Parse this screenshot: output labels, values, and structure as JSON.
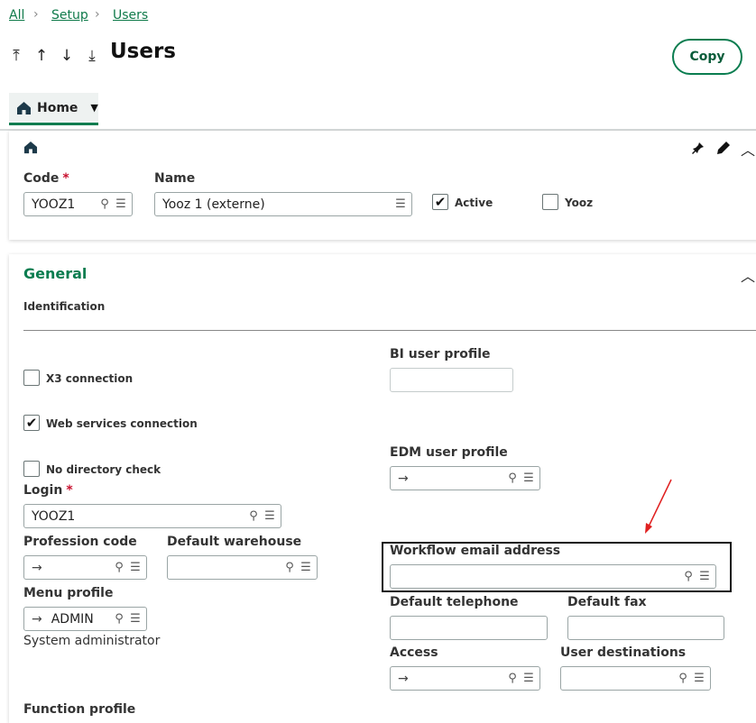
{
  "breadcrumb": {
    "items": [
      "All",
      "Setup",
      "Users"
    ]
  },
  "page": {
    "title": "Users",
    "copy_label": "Copy"
  },
  "tabs": {
    "home_label": "Home"
  },
  "header_card": {
    "code_label": "Code",
    "code_value": "YOOZ1",
    "name_label": "Name",
    "name_value": "Yooz 1 (externe)",
    "active_label": "Active",
    "active_checked": true,
    "yooz_label": "Yooz",
    "yooz_checked": false
  },
  "general": {
    "title": "General",
    "identification_label": "Identification",
    "x3_connection_label": "X3 connection",
    "web_services_label": "Web services connection",
    "no_directory_label": "No directory check",
    "login_label": "Login",
    "login_value": "YOOZ1",
    "profession_code_label": "Profession code",
    "default_warehouse_label": "Default warehouse",
    "menu_profile_label": "Menu profile",
    "menu_profile_value": "ADMIN",
    "menu_profile_desc": "System administrator",
    "function_profile_label": "Function profile",
    "bi_user_profile_label": "BI user profile",
    "edm_user_profile_label": "EDM user profile",
    "workflow_email_label": "Workflow email address",
    "default_telephone_label": "Default telephone",
    "default_fax_label": "Default fax",
    "access_label": "Access",
    "user_destinations_label": "User destinations"
  },
  "icons": {
    "arrow_right": "→",
    "search": "⚲",
    "menu": "☰",
    "check": "✔"
  }
}
